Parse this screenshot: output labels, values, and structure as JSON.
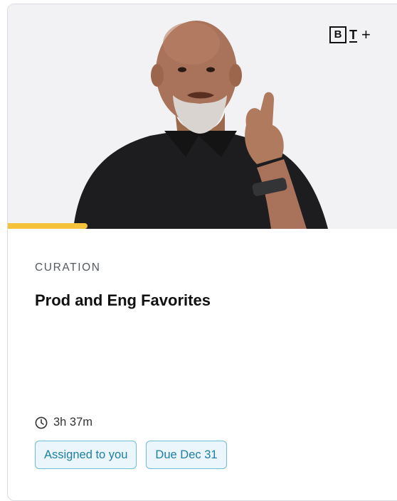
{
  "card": {
    "hero": {
      "logo": {
        "box_letter": "B",
        "second_letter": "T",
        "plus": "+"
      },
      "progress_percent": 20
    },
    "category": "CURATION",
    "title": "Prod and Eng Favorites",
    "duration": "3h 37m",
    "badges": [
      "Assigned to you",
      "Due Dec 31"
    ],
    "colors": {
      "progress": "#f5c23b",
      "badge_border": "#6dbcdc",
      "badge_text": "#1f7ea5",
      "badge_bg": "#eaf6fb"
    },
    "icons": {
      "duration": "clock-icon",
      "brand": "bt-plus-logo"
    }
  }
}
